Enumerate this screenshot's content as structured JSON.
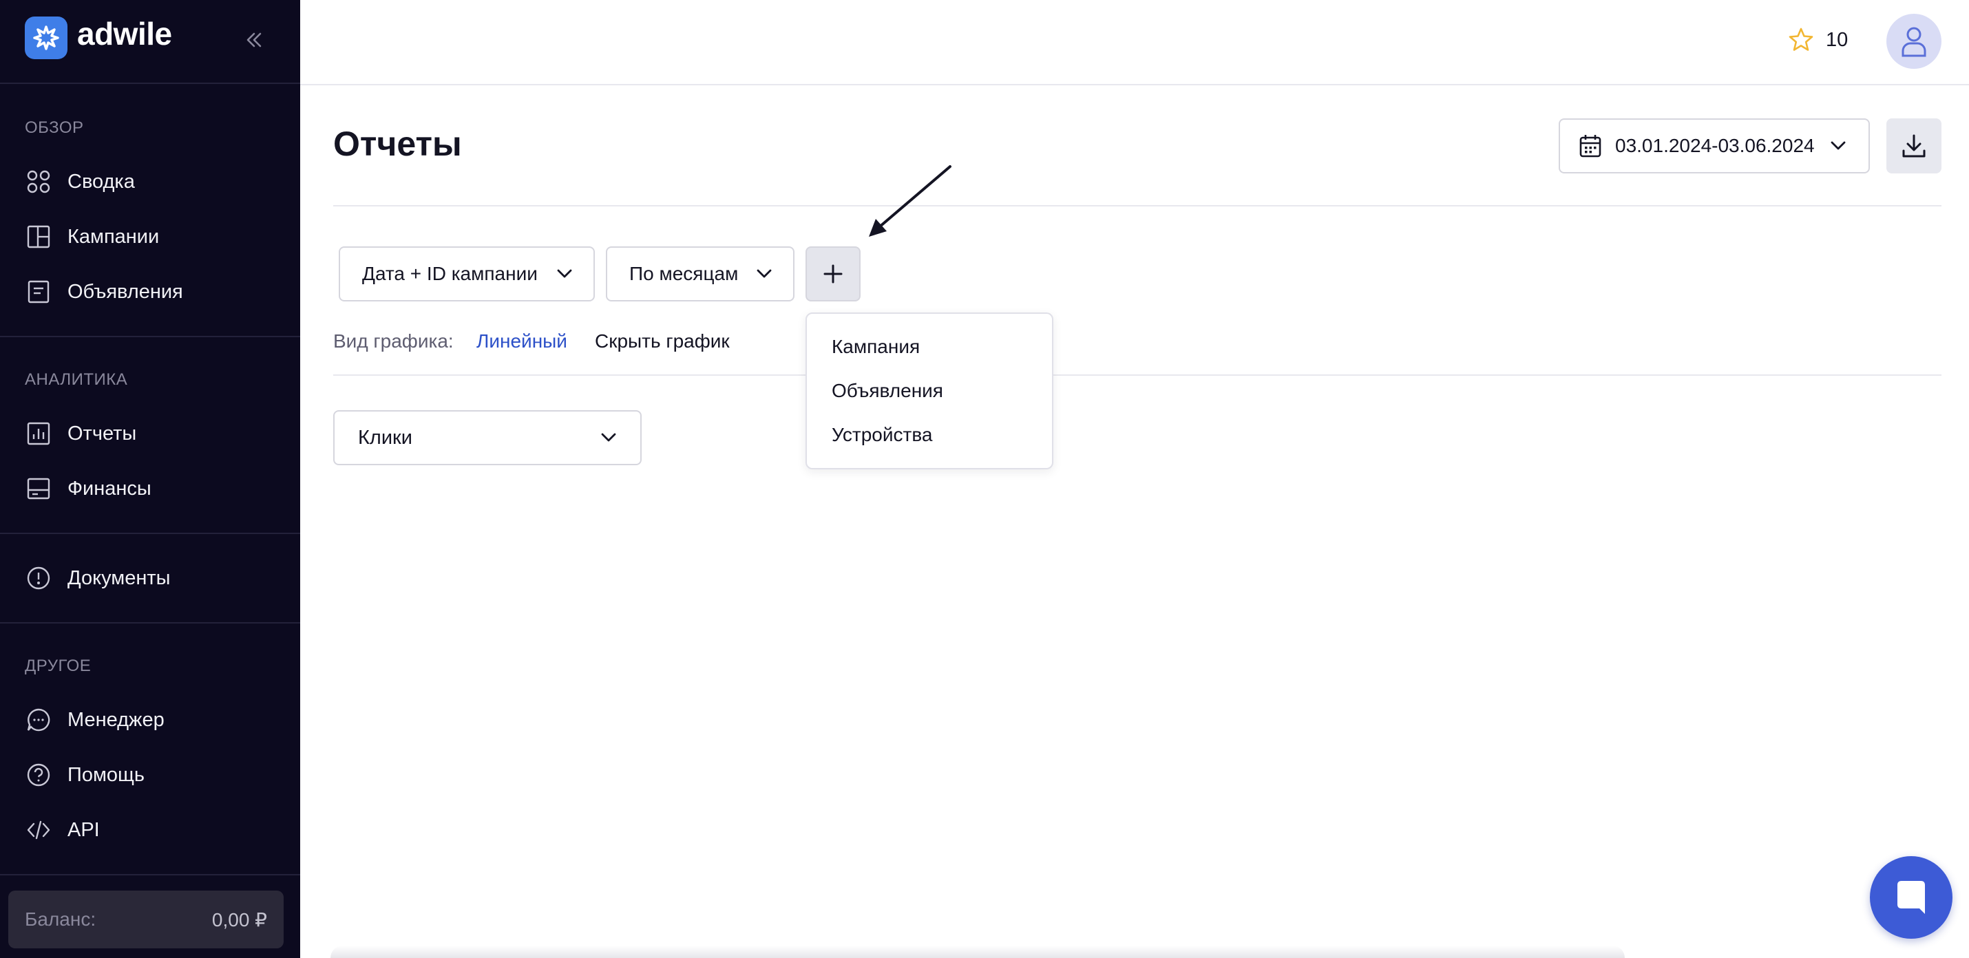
{
  "sidebar": {
    "brand": "adwile",
    "sections": [
      {
        "title": "ОБЗОР"
      },
      {
        "title": "АНАЛИТИКА"
      },
      {
        "title": "ДРУГОЕ"
      }
    ],
    "items": [
      {
        "label": "Сводка",
        "icon": "grid-icon"
      },
      {
        "label": "Кампании",
        "icon": "layout-icon"
      },
      {
        "label": "Объявления",
        "icon": "document-icon"
      },
      {
        "label": "Отчеты",
        "icon": "bar-chart-icon"
      },
      {
        "label": "Финансы",
        "icon": "card-icon"
      },
      {
        "label": "Документы",
        "icon": "alert-circle-icon"
      },
      {
        "label": "Менеджер",
        "icon": "chat-icon"
      },
      {
        "label": "Помощь",
        "icon": "help-circle-icon"
      },
      {
        "label": "API",
        "icon": "code-icon"
      }
    ],
    "balance": {
      "label": "Баланс:",
      "value": "0,00 ₽"
    }
  },
  "header": {
    "stars": "10"
  },
  "main": {
    "title": "Отчеты",
    "date_range": "03.01.2024-03.06.2024",
    "grouping_select": "Дата + ID кампании",
    "period_select": "По месяцам",
    "chart_type_label": "Вид графика:",
    "chart_type_value": "Линейный",
    "hide_chart": "Скрыть график",
    "metric_select": "Клики",
    "add_menu": [
      "Кампания",
      "Объявления",
      "Устройства"
    ]
  },
  "colors": {
    "sidebar_bg": "#0c0a1f",
    "accent": "#3d5bd6",
    "link": "#2c50c8",
    "star": "#f2b632"
  }
}
